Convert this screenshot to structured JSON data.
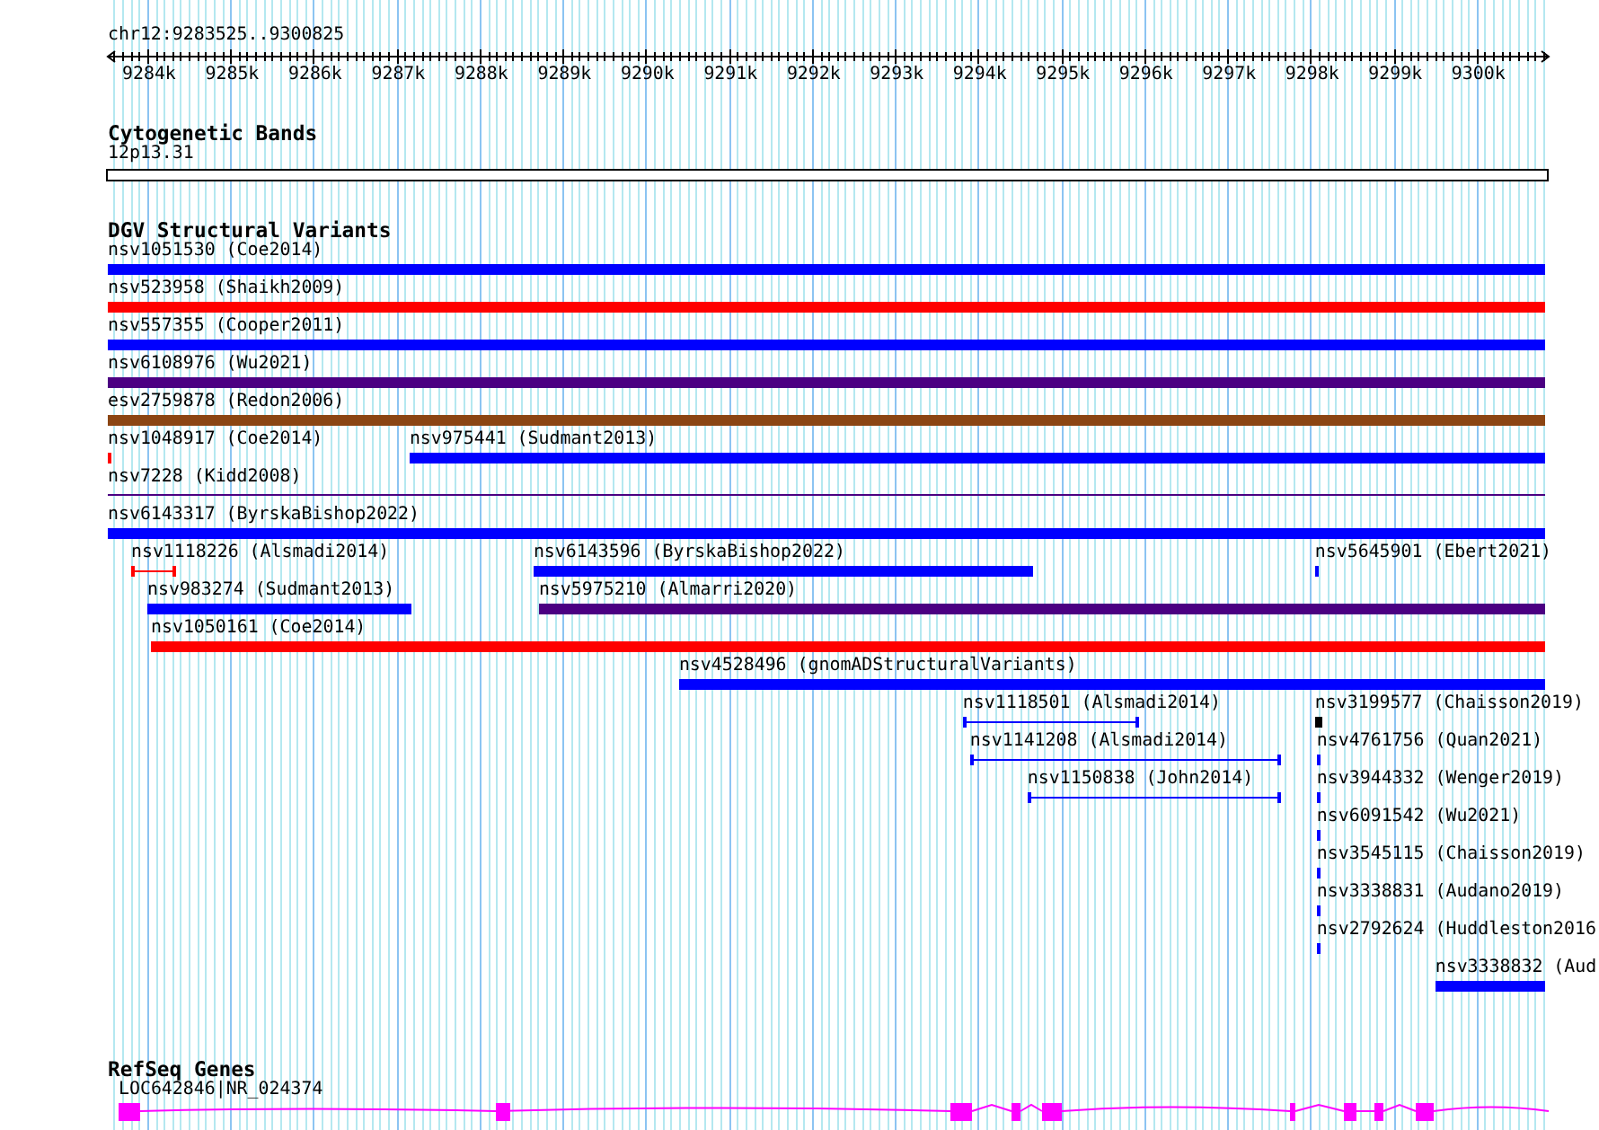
{
  "ruler": {
    "location": "chr12:9283525..9300825",
    "ticks": [
      {
        "label": "9284k"
      },
      {
        "label": "9285k"
      },
      {
        "label": "9286k"
      },
      {
        "label": "9287k"
      },
      {
        "label": "9288k"
      },
      {
        "label": "9289k"
      },
      {
        "label": "9290k"
      },
      {
        "label": "9291k"
      },
      {
        "label": "9292k"
      },
      {
        "label": "9293k"
      },
      {
        "label": "9294k"
      },
      {
        "label": "9295k"
      },
      {
        "label": "9296k"
      },
      {
        "label": "9297k"
      },
      {
        "label": "9298k"
      },
      {
        "label": "9299k"
      },
      {
        "label": "9300k"
      }
    ]
  },
  "tracks": [
    {
      "kind": "cytoband",
      "title": "Cytogenetic Bands",
      "band": "12p13.31"
    },
    {
      "kind": "features",
      "title": "DGV Structural Variants",
      "rows": [
        {
          "features": [
            {
              "label": "nsv1051530 (Coe2014)",
              "kind": "bar",
              "color": "#0000ff"
            }
          ]
        },
        {
          "features": [
            {
              "label": "nsv523958 (Shaikh2009)",
              "kind": "bar",
              "color": "#ff0000"
            }
          ]
        },
        {
          "features": [
            {
              "label": "nsv557355 (Cooper2011)",
              "kind": "bar",
              "color": "#0000ff"
            }
          ]
        },
        {
          "features": [
            {
              "label": "nsv6108976 (Wu2021)",
              "kind": "bar",
              "color": "#4b0082"
            }
          ]
        },
        {
          "features": [
            {
              "label": "esv2759878 (Redon2006)",
              "kind": "bar",
              "color": "#8b4513"
            }
          ]
        },
        {
          "features": [
            {
              "label": "nsv1048917 (Coe2014)",
              "kind": "bar",
              "color": "#ff0000"
            },
            {
              "label": "nsv975441 (Sudmant2013)",
              "kind": "bar",
              "color": "#0000ff"
            }
          ]
        },
        {
          "features": [
            {
              "label": "nsv7228 (Kidd2008)",
              "kind": "line",
              "color": "#4b0082"
            }
          ]
        },
        {
          "features": [
            {
              "label": "nsv6143317 (ByrskaBishop2022)",
              "kind": "bar",
              "color": "#0000ff"
            }
          ]
        },
        {
          "features": [
            {
              "label": "nsv1118226 (Alsmadi2014)",
              "kind": "interval",
              "color": "#ff0000"
            },
            {
              "label": "nsv6143596 (ByrskaBishop2022)",
              "kind": "bar",
              "color": "#0000ff"
            },
            {
              "label": "nsv5645901 (Ebert2021)",
              "kind": "bar",
              "color": "#0000ff"
            }
          ]
        },
        {
          "features": [
            {
              "label": "nsv983274 (Sudmant2013)",
              "kind": "bar",
              "color": "#0000ff"
            },
            {
              "label": "nsv5975210 (Almarri2020)",
              "kind": "bar",
              "color": "#4b0082"
            }
          ]
        },
        {
          "features": [
            {
              "label": "nsv1050161 (Coe2014)",
              "kind": "bar",
              "color": "#ff0000"
            }
          ]
        },
        {
          "features": [
            {
              "label": "nsv4528496 (gnomADStructuralVariants)",
              "kind": "bar",
              "color": "#0000ff"
            }
          ]
        },
        {
          "features": [
            {
              "label": "nsv1118501 (Alsmadi2014)",
              "kind": "interval",
              "color": "#0000ff"
            },
            {
              "label": "nsv3199577 (Chaisson2019)",
              "kind": "bar",
              "color": "#000000"
            }
          ]
        },
        {
          "features": [
            {
              "label": "nsv1141208 (Alsmadi2014)",
              "kind": "interval",
              "color": "#0000ff"
            },
            {
              "label": "nsv4761756 (Quan2021)",
              "kind": "bar",
              "color": "#0000ff"
            }
          ]
        },
        {
          "features": [
            {
              "label": "nsv1150838 (John2014)",
              "kind": "interval",
              "color": "#0000ff"
            },
            {
              "label": "nsv3944332 (Wenger2019)",
              "kind": "bar",
              "color": "#0000ff"
            }
          ]
        },
        {
          "features": [
            {
              "label": "nsv6091542 (Wu2021)",
              "kind": "bar",
              "color": "#0000ff"
            }
          ]
        },
        {
          "features": [
            {
              "label": "nsv3545115 (Chaisson2019)",
              "kind": "bar",
              "color": "#0000ff"
            }
          ]
        },
        {
          "features": [
            {
              "label": "nsv3338831 (Audano2019)",
              "kind": "bar",
              "color": "#0000ff"
            }
          ]
        },
        {
          "features": [
            {
              "label": "nsv2792624 (Huddleston2016",
              "kind": "bar",
              "color": "#0000ff"
            }
          ]
        },
        {
          "features": [
            {
              "label": "nsv3338832 (Aud",
              "kind": "bar",
              "color": "#0000ff"
            }
          ]
        }
      ]
    },
    {
      "kind": "gene",
      "title": "RefSeq Genes",
      "gene": "LOC642846|NR_024374"
    }
  ]
}
